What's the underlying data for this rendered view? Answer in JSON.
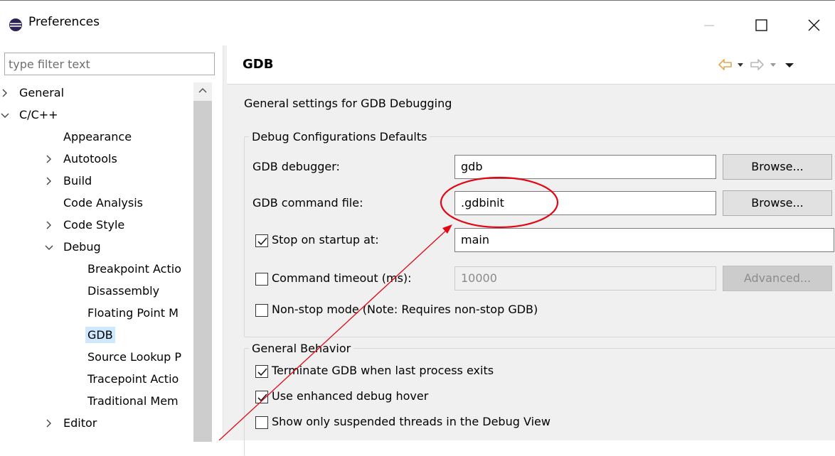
{
  "window": {
    "title": "Preferences",
    "controls": {
      "minimize": "minimize",
      "maximize": "maximize",
      "close": "close"
    }
  },
  "filter": {
    "placeholder": "type filter text",
    "value": ""
  },
  "tree": {
    "items": [
      {
        "label": "General",
        "level": 0,
        "expander": "collapsed"
      },
      {
        "label": "C/C++",
        "level": 0,
        "expander": "expanded"
      },
      {
        "label": "Appearance",
        "level": 1,
        "expander": "none"
      },
      {
        "label": "Autotools",
        "level": 1,
        "expander": "collapsed"
      },
      {
        "label": "Build",
        "level": 1,
        "expander": "collapsed"
      },
      {
        "label": "Code Analysis",
        "level": 1,
        "expander": "none"
      },
      {
        "label": "Code Style",
        "level": 1,
        "expander": "collapsed"
      },
      {
        "label": "Debug",
        "level": 1,
        "expander": "expanded"
      },
      {
        "label": "Breakpoint Actio",
        "level": 2,
        "expander": "none"
      },
      {
        "label": "Disassembly",
        "level": 2,
        "expander": "none"
      },
      {
        "label": "Floating Point M",
        "level": 2,
        "expander": "none"
      },
      {
        "label": "GDB",
        "level": 2,
        "expander": "none",
        "selected": true
      },
      {
        "label": "Source Lookup P",
        "level": 2,
        "expander": "none"
      },
      {
        "label": "Tracepoint Actio",
        "level": 2,
        "expander": "none"
      },
      {
        "label": "Traditional Mem",
        "level": 2,
        "expander": "none"
      },
      {
        "label": "Editor",
        "level": 1,
        "expander": "collapsed"
      }
    ]
  },
  "page": {
    "title": "GDB",
    "description": "General settings for GDB Debugging",
    "nav_icons": [
      "back-arrow-icon",
      "dropdown-icon",
      "forward-arrow-icon",
      "dropdown-icon",
      "menu-icon"
    ]
  },
  "debug_defaults": {
    "legend": "Debug Configurations Defaults",
    "gdb_debugger_label": "GDB debugger:",
    "gdb_debugger_value": "gdb",
    "gdb_command_file_label": "GDB command file:",
    "gdb_command_file_value": ".gdbinit",
    "browse_label": "Browse...",
    "stop_on_startup_label": "Stop on startup at:",
    "stop_on_startup_checked": true,
    "stop_on_startup_value": "main",
    "command_timeout_label": "Command timeout (ms):",
    "command_timeout_checked": false,
    "command_timeout_value": "10000",
    "advanced_label": "Advanced...",
    "non_stop_label": "Non-stop mode (Note: Requires non-stop GDB)",
    "non_stop_checked": false
  },
  "general_behavior": {
    "legend": "General Behavior",
    "terminate_label": "Terminate GDB when last process exits",
    "terminate_checked": true,
    "hover_label": "Use enhanced debug hover",
    "hover_checked": true,
    "suspended_label": "Show only suspended threads in the Debug View",
    "suspended_checked": false
  },
  "colors": {
    "selection": "#cde8ff",
    "annotation": "#e30613",
    "nav_back_arrow": "#e0a84b",
    "panel_background": "#f0f0f0"
  }
}
